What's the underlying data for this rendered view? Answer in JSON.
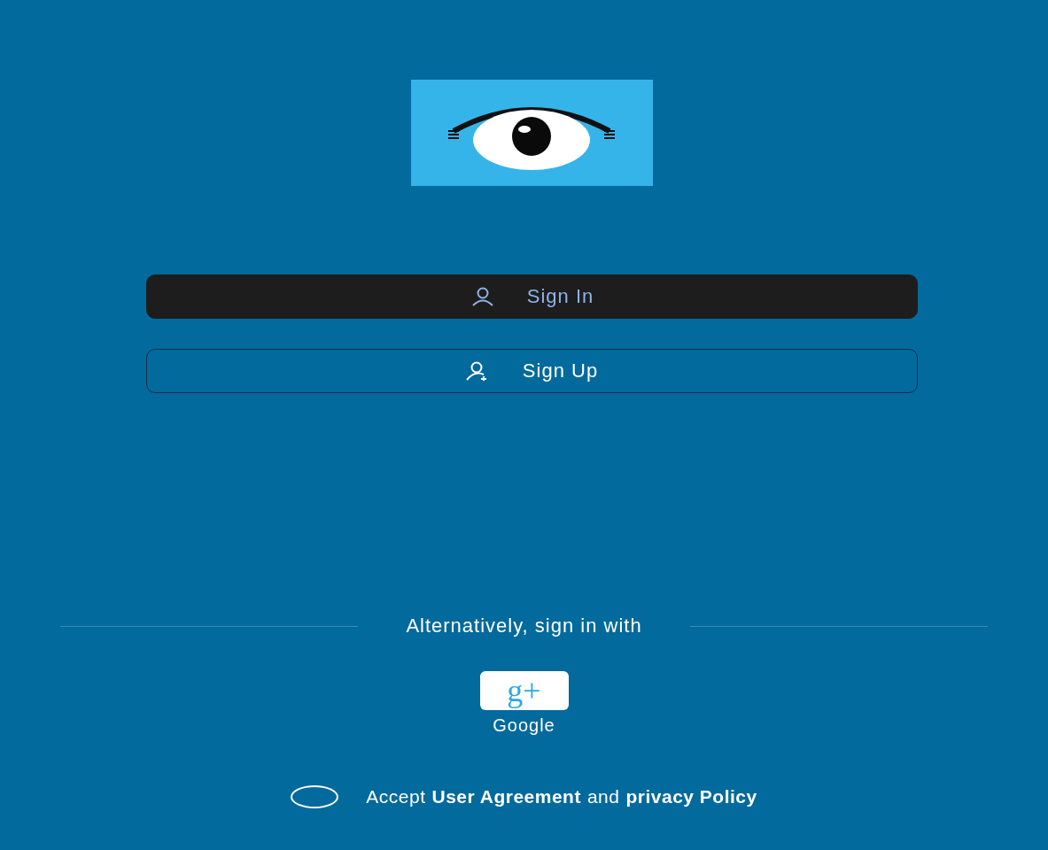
{
  "buttons": [
    {
      "kind": "filled",
      "label": "Sign In"
    },
    {
      "kind": "outline",
      "label": "Sign Up"
    }
  ],
  "alternative": {
    "label": "Alternatively, sign in with"
  },
  "social": [
    {
      "glyph": "g+",
      "label": "Google"
    }
  ],
  "agreement": {
    "checked": false,
    "parts": [
      {
        "kind": "text",
        "text": "Accept"
      },
      {
        "kind": "link",
        "text": "User Agreement"
      },
      {
        "kind": "text",
        "text": "and"
      },
      {
        "kind": "link",
        "text": "privacy Policy"
      }
    ]
  }
}
